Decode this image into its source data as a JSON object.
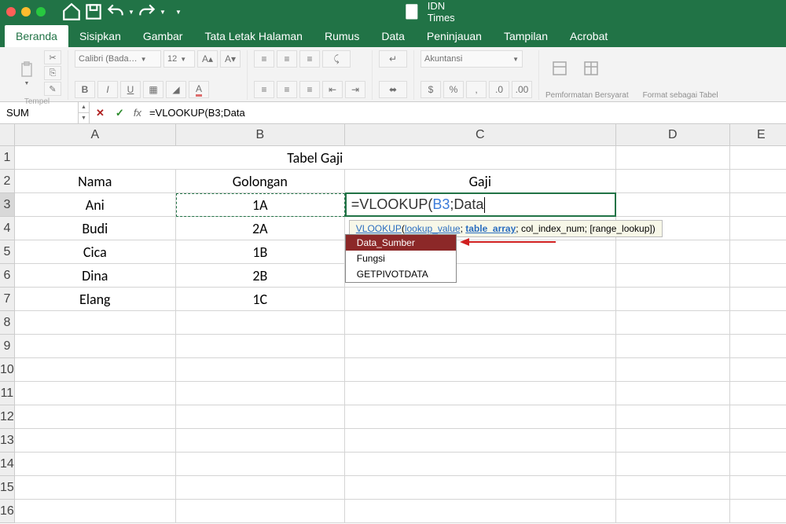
{
  "titlebar": {
    "doc_name": "IDN Times"
  },
  "tabs": [
    "Beranda",
    "Sisipkan",
    "Gambar",
    "Tata Letak Halaman",
    "Rumus",
    "Data",
    "Peninjauan",
    "Tampilan",
    "Acrobat"
  ],
  "ribbon": {
    "clipboard": {
      "label": "Tempel"
    },
    "font": {
      "name": "Calibri (Bada…",
      "size": "12"
    },
    "num_format": "Akuntansi",
    "cond_format": "Pemformatan Bersyarat",
    "table_format": "Format sebagai Tabel"
  },
  "formula_bar": {
    "name_box": "SUM",
    "fx": "fx",
    "formula": "=VLOOKUP(B3;Data"
  },
  "columns": [
    "A",
    "B",
    "C",
    "D",
    "E"
  ],
  "rows_visible": 16,
  "sheet": {
    "title": "Tabel Gaji",
    "headers": {
      "a": "Nama",
      "b": "Golongan",
      "c": "Gaji"
    },
    "data": [
      {
        "nama": "Ani",
        "gol": "1A"
      },
      {
        "nama": "Budi",
        "gol": "2A"
      },
      {
        "nama": "Cica",
        "gol": "1B"
      },
      {
        "nama": "Dina",
        "gol": "2B"
      },
      {
        "nama": "Elang",
        "gol": "1C"
      }
    ]
  },
  "cell_edit": {
    "prefix": "=VLOOKUP(",
    "ref": "B3",
    "suffix": ";Data"
  },
  "tooltip": {
    "fn": "VLOOKUP",
    "arg1": "lookup_value",
    "arg2": "table_array",
    "arg3": "col_index_num",
    "arg4": "[range_lookup]"
  },
  "autocomplete": {
    "items": [
      "Data_Sumber",
      "Fungsi",
      "GETPIVOTDATA"
    ],
    "selected": 0
  }
}
